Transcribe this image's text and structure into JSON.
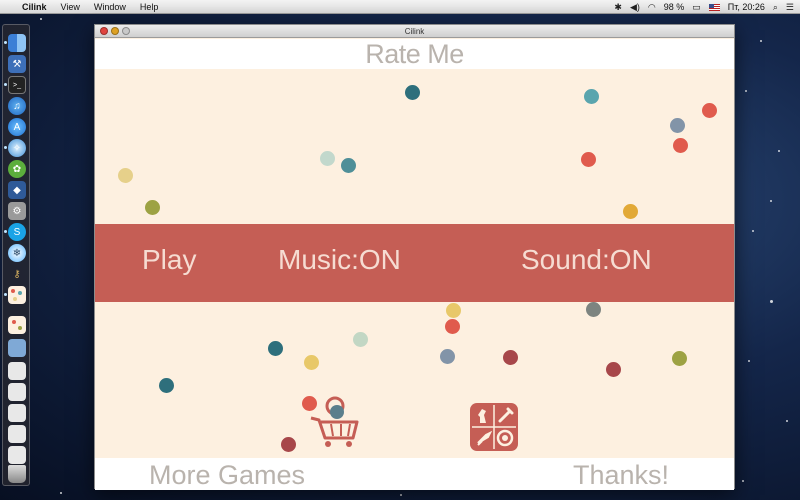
{
  "menubar": {
    "app_name": "Cilink",
    "items": [
      "View",
      "Window",
      "Help"
    ],
    "battery": "98 %",
    "clock": "Пт, 20:26"
  },
  "window": {
    "title": "Cilink"
  },
  "game": {
    "rate_label": "Rate Me",
    "play_label": "Play",
    "music_label": "Music:ON",
    "sound_label": "Sound:ON",
    "more_games_label": "More Games",
    "thanks_label": "Thanks!",
    "colors": {
      "background": "#fdf0e0",
      "band": "#c55e55",
      "text_light": "#b9b3ad"
    },
    "dot_colors": [
      "#2e6f7c",
      "#5aa5ae",
      "#e05b4d",
      "#c2d8cc",
      "#e6d08a",
      "#9da243",
      "#8294a8",
      "#7d8480",
      "#a7474a",
      "#e2a937",
      "#c2d7c4",
      "#e8c869"
    ]
  },
  "dock": {
    "icons": [
      "finder-icon",
      "xcode-icon",
      "terminal-icon",
      "itunes-icon",
      "app-store-icon",
      "safari-icon",
      "grab-icon",
      "dashboard-icon",
      "system-preferences-icon",
      "skype-icon",
      "network-icon",
      "keychain-icon",
      "cilink-icon",
      "cilink-doc-icon",
      "folder-icon",
      "document-icon",
      "document-icon",
      "document-icon",
      "document-icon",
      "document-icon",
      "trash-icon"
    ]
  }
}
